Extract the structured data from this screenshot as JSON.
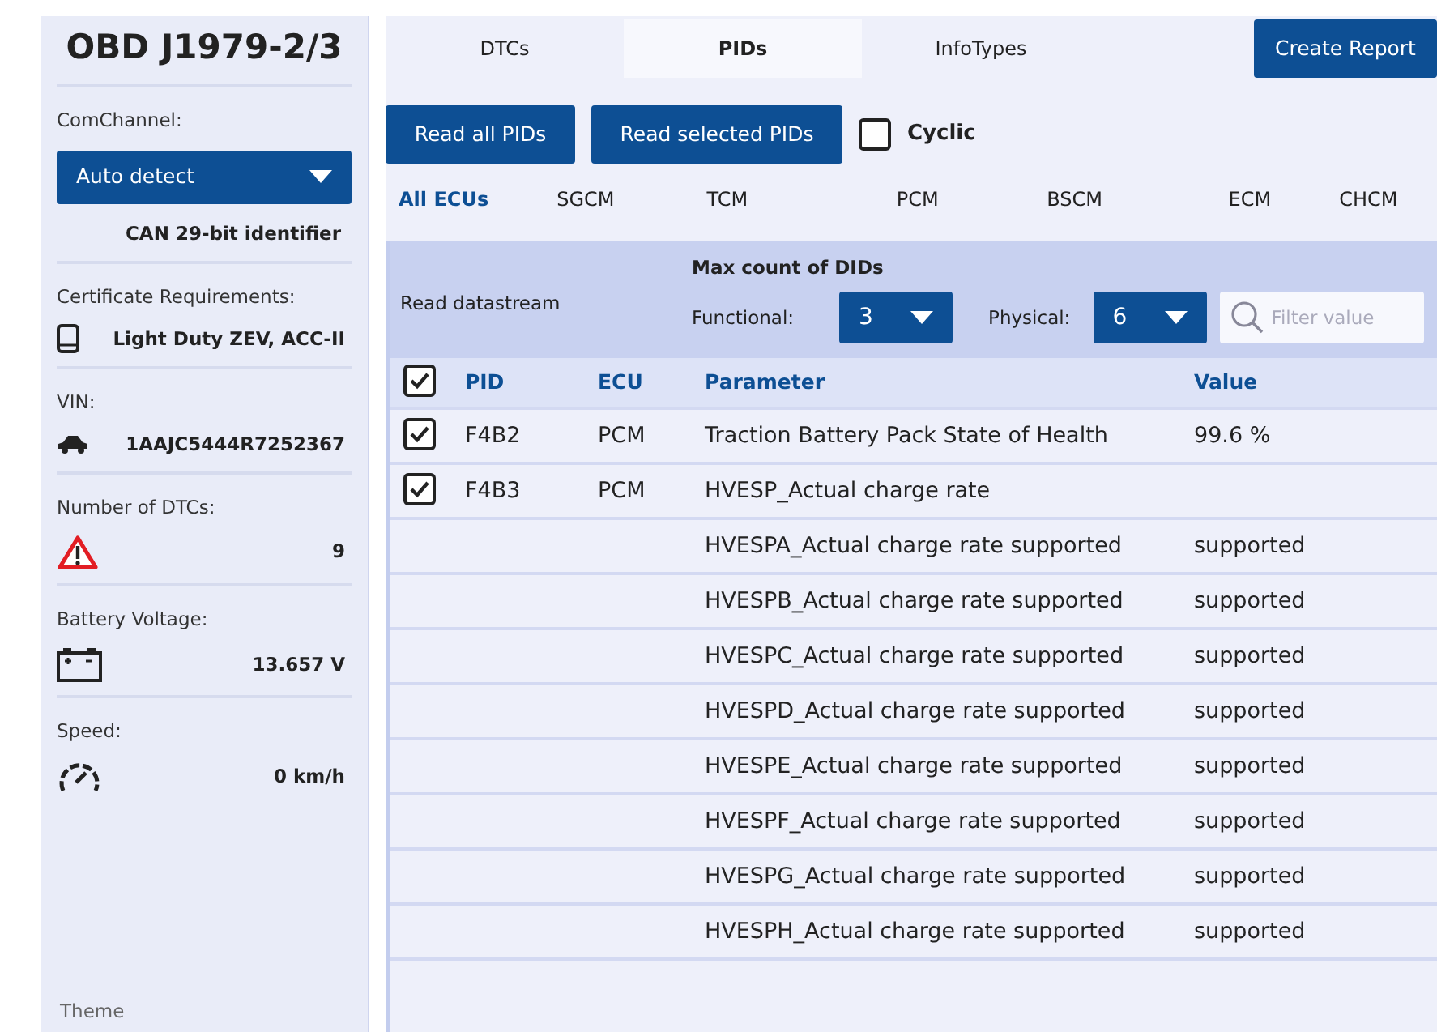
{
  "sidebar": {
    "title": "OBD J1979-2/3",
    "com_channel": {
      "label": "ComChannel:",
      "value": "Auto detect",
      "protocol": "CAN 29-bit identifier"
    },
    "items": [
      {
        "kind": "certificate",
        "label": "Certificate Requirements:",
        "value": "Light Duty ZEV, ACC-II"
      },
      {
        "kind": "vin",
        "label": "VIN:",
        "value": "1AAJC5444R7252367"
      },
      {
        "kind": "dtcs",
        "label": "Number of DTCs:",
        "value": "9"
      },
      {
        "kind": "battery",
        "label": "Battery Voltage:",
        "value": "13.657 V"
      },
      {
        "kind": "speed",
        "label": "Speed:",
        "value": "0 km/h"
      }
    ],
    "theme_label": "Theme"
  },
  "tabs": [
    {
      "label": "DTCs",
      "selected": false
    },
    {
      "label": "PIDs",
      "selected": true
    },
    {
      "label": "InfoTypes",
      "selected": false
    }
  ],
  "create_report": "Create Report",
  "toolbar": {
    "buttons": [
      "Read all PIDs",
      "Read selected PIDs"
    ],
    "cyclic": {
      "label": "Cyclic",
      "checked": false
    }
  },
  "ecu_tabs": [
    {
      "label": "All ECUs",
      "selected": true
    },
    {
      "label": "SGCM",
      "selected": false
    },
    {
      "label": "TCM",
      "selected": false
    },
    {
      "label": "PCM",
      "selected": false
    },
    {
      "label": "BSCM",
      "selected": false
    },
    {
      "label": "ECM",
      "selected": false
    },
    {
      "label": "CHCM",
      "selected": false
    }
  ],
  "datastream": {
    "label": "Read datastream",
    "max_count_title": "Max count of DIDs",
    "functional_label": "Functional:",
    "functional_value": "3",
    "physical_label": "Physical:",
    "physical_value": "6",
    "filter_placeholder": "Filter value"
  },
  "table": {
    "select_all_checked": true,
    "columns": [
      "PID",
      "ECU",
      "Parameter",
      "Value"
    ],
    "rows": [
      {
        "kind": "pid",
        "checked": true,
        "pid": "F4B2",
        "ecu": "PCM",
        "parameter": "Traction Battery Pack State of Health",
        "value": "99.6 %"
      },
      {
        "kind": "pid",
        "checked": true,
        "pid": "F4B3",
        "ecu": "PCM",
        "parameter": "HVESP_Actual charge rate"
      },
      {
        "kind": "sub",
        "parameter": "HVESPA_Actual charge rate supported",
        "value": "supported"
      },
      {
        "kind": "sub",
        "parameter": "HVESPB_Actual charge rate supported",
        "value": "supported"
      },
      {
        "kind": "sub",
        "parameter": "HVESPC_Actual charge rate supported",
        "value": "supported"
      },
      {
        "kind": "sub",
        "parameter": "HVESPD_Actual charge rate supported",
        "value": "supported"
      },
      {
        "kind": "sub",
        "parameter": "HVESPE_Actual charge rate supported",
        "value": "supported"
      },
      {
        "kind": "sub",
        "parameter": "HVESPF_Actual charge rate supported",
        "value": "supported"
      },
      {
        "kind": "sub",
        "parameter": "HVESPG_Actual charge rate supported",
        "value": "supported"
      },
      {
        "kind": "sub",
        "parameter": "HVESPH_Actual charge rate supported",
        "value": "supported"
      }
    ]
  }
}
